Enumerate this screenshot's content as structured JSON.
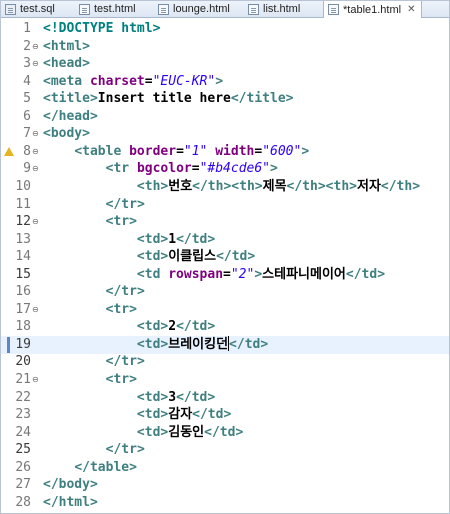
{
  "tabs": [
    {
      "label": "test.sql",
      "icon": "sql-file-icon",
      "active": false
    },
    {
      "label": "test.html",
      "icon": "html-file-icon",
      "active": false
    },
    {
      "label": "lounge.html",
      "icon": "html-file-icon",
      "active": false
    },
    {
      "label": "list.html",
      "icon": "html-file-icon",
      "active": false
    },
    {
      "label": "*table1.html",
      "icon": "html-file-icon",
      "active": true,
      "close": "✕"
    }
  ],
  "editor": {
    "current_line": 19,
    "lines": [
      {
        "n": "1",
        "text": "<!DOCTYPE html>"
      },
      {
        "n": "2",
        "text": "<html>"
      },
      {
        "n": "3",
        "text": "<head>"
      },
      {
        "n": "4",
        "text": "<meta charset=\"EUC-KR\">"
      },
      {
        "n": "5",
        "text": "<title>Insert title here</title>"
      },
      {
        "n": "6",
        "text": "</head>"
      },
      {
        "n": "7",
        "text": "<body>"
      },
      {
        "n": "8",
        "text": "    <table border=\"1\" width=\"600\">"
      },
      {
        "n": "9",
        "text": "        <tr bgcolor=\"#b4cde6\">"
      },
      {
        "n": "10",
        "text": "            <th>번호</th><th>제목</th><th>저자</th>"
      },
      {
        "n": "11",
        "text": "        </tr>"
      },
      {
        "n": "12",
        "text": "        <tr>"
      },
      {
        "n": "13",
        "text": "            <td>1</td>"
      },
      {
        "n": "14",
        "text": "            <td>이클립스</td>"
      },
      {
        "n": "15",
        "text": "            <td rowspan=\"2\">스테파니메이어</td>"
      },
      {
        "n": "16",
        "text": "        </tr>"
      },
      {
        "n": "17",
        "text": "        <tr>"
      },
      {
        "n": "18",
        "text": "            <td>2</td>"
      },
      {
        "n": "19",
        "text": "            <td>브레이킹던</td>"
      },
      {
        "n": "20",
        "text": "        </tr>"
      },
      {
        "n": "21",
        "text": "        <tr>"
      },
      {
        "n": "22",
        "text": "            <td>3</td>"
      },
      {
        "n": "23",
        "text": "            <td>감자</td>"
      },
      {
        "n": "24",
        "text": "            <td>김동인</td>"
      },
      {
        "n": "25",
        "text": "        </tr>"
      },
      {
        "n": "26",
        "text": "    </table>"
      },
      {
        "n": "27",
        "text": "</body>"
      },
      {
        "n": "28",
        "text": "</html>"
      }
    ],
    "fold_lines": [
      "2",
      "3",
      "7",
      "8",
      "9",
      "12",
      "17",
      "21"
    ],
    "warning_line": "8",
    "marked_lines": [
      "12",
      "15",
      "19",
      "20",
      "25"
    ],
    "colors": {
      "tag": "#3f7f7f",
      "attribute": "#7f007f",
      "value": "#2a00ff",
      "doctype": "#008080",
      "current_line_bg": "#e8f2fe",
      "warning": "#e6b422"
    }
  }
}
